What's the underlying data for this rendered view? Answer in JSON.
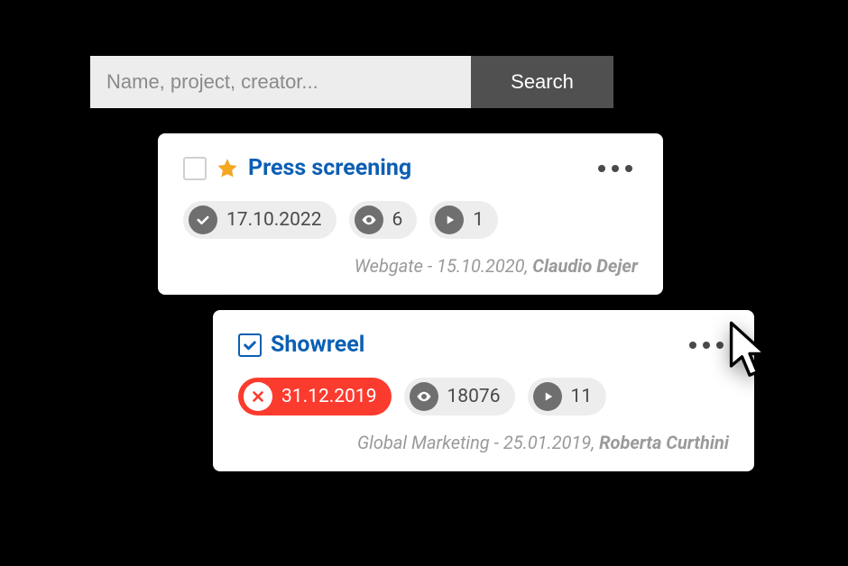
{
  "search": {
    "placeholder": "Name, project, creator...",
    "button": "Search"
  },
  "cards": [
    {
      "checked": false,
      "starred": true,
      "title": "Press screening",
      "status": {
        "style": "normal",
        "date": "17.10.2022"
      },
      "views": "6",
      "plays": "1",
      "meta_project": "Webgate",
      "meta_date": "15.10.2020",
      "creator": "Claudio Dejer"
    },
    {
      "checked": true,
      "starred": false,
      "title": "Showreel",
      "status": {
        "style": "danger",
        "date": "31.12.2019"
      },
      "views": "18076",
      "plays": "11",
      "meta_project": "Global Marketing",
      "meta_date": "25.01.2019",
      "creator": "Roberta Curthini"
    }
  ]
}
